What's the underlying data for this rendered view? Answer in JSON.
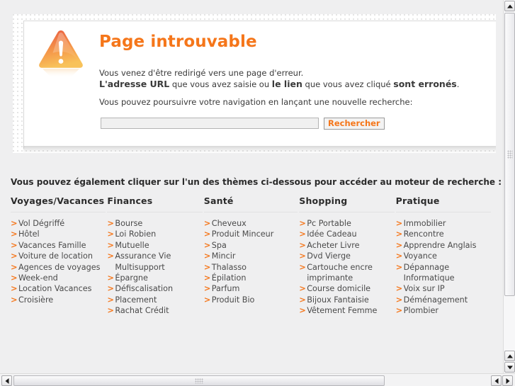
{
  "error_panel": {
    "icon": "warning-triangle-icon",
    "heading": "Page introuvable",
    "paragraph1_part1": "Vous venez d'être redirigé vers une page d'erreur.",
    "paragraph1_strong1": "L'adresse URL",
    "paragraph1_mid1": " que vous avez saisie ou ",
    "paragraph1_strong2": "le lien",
    "paragraph1_mid2": " que vous avez cliqué ",
    "paragraph1_strong3": "sont erronés",
    "paragraph1_end": ".",
    "paragraph2": "Vous pouvez poursuivre votre navigation en lançant une nouvelle recherche:",
    "search_value": "",
    "search_placeholder": "",
    "search_button_label": "Rechercher"
  },
  "themes": {
    "prompt": "Vous pouvez également cliquer sur l'un des thèmes ci-dessous pour accéder au moteur de recherche :",
    "columns": [
      {
        "title": "Voyages/Vacances",
        "links": [
          "Vol Dégriffé",
          "Hôtel",
          "Vacances Famille",
          "Voiture de location",
          "Agences de voyages",
          "Week-end",
          "Location Vacances",
          "Croisière"
        ]
      },
      {
        "title": "Finances",
        "links": [
          "Bourse",
          "Loi Robien",
          "Mutuelle",
          "Assurance Vie Multisupport",
          "Épargne",
          "Défiscalisation",
          "Placement",
          "Rachat Crédit"
        ]
      },
      {
        "title": "Santé",
        "links": [
          "Cheveux",
          "Produit Minceur",
          "Spa",
          "Mincir",
          "Thalasso",
          "Épilation",
          "Parfum",
          "Produit Bio"
        ]
      },
      {
        "title": "Shopping",
        "links": [
          "Pc Portable",
          "Idée Cadeau",
          "Acheter Livre",
          "Dvd Vierge",
          "Cartouche encre imprimante",
          "Course domicile",
          "Bijoux Fantaisie",
          "Vêtement Femme"
        ]
      },
      {
        "title": "Pratique",
        "links": [
          "Immobilier",
          "Rencontre",
          "Apprendre Anglais",
          "Voyance",
          "Dépannage Informatique",
          "Voix sur IP",
          "Déménagement",
          "Plombier"
        ]
      }
    ]
  },
  "colors": {
    "accent_orange": "#f5761a",
    "text_dark": "#2b2b2b",
    "link_text": "#4a4a4a",
    "page_background": "#efeff0",
    "panel_background": "#ffffff"
  },
  "scrollbars": {
    "vertical": {
      "up_icon": "scroll-up-arrow-icon",
      "down_icon": "scroll-down-arrow-icon"
    },
    "horizontal": {
      "left_icon": "scroll-left-arrow-icon",
      "right_icon": "scroll-right-arrow-icon"
    }
  }
}
